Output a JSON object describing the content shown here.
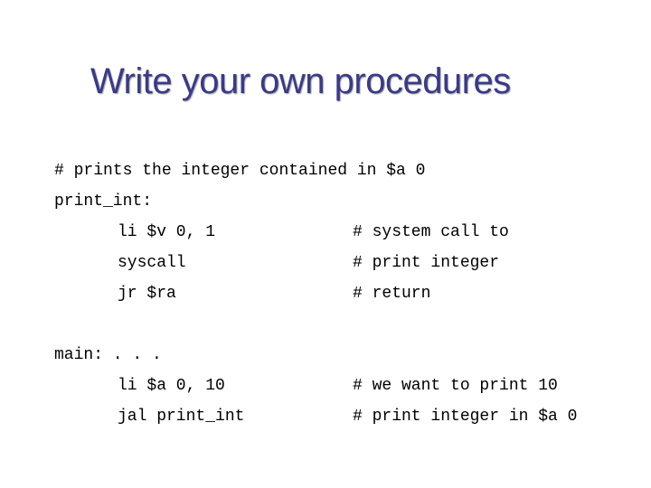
{
  "title": "Write your own procedures",
  "lines": {
    "comment_top": "# prints the integer contained in $a 0",
    "label1": "print_int:",
    "i1": "li $v 0, 1",
    "c1": "# system call to",
    "i2": "syscall",
    "c2": "# print integer",
    "i3": "jr $ra",
    "c3": "# return",
    "label2": "main: . . .",
    "i4": "li $a 0, 10",
    "c4": "# we want to print 10",
    "i5": "jal print_int",
    "c5": "# print integer in $a 0"
  }
}
